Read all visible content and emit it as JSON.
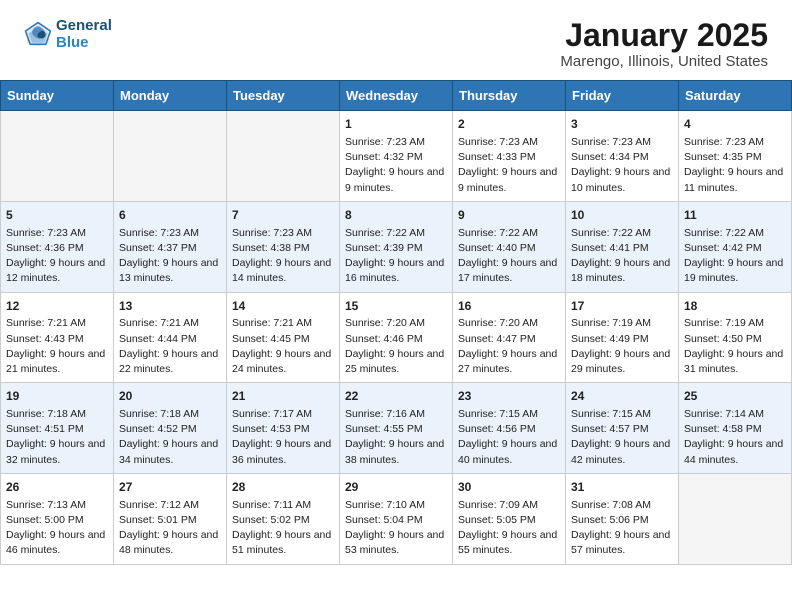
{
  "header": {
    "logo_line1": "General",
    "logo_line2": "Blue",
    "title": "January 2025",
    "subtitle": "Marengo, Illinois, United States"
  },
  "weekdays": [
    "Sunday",
    "Monday",
    "Tuesday",
    "Wednesday",
    "Thursday",
    "Friday",
    "Saturday"
  ],
  "weeks": [
    [
      {
        "day": "",
        "sunrise": "",
        "sunset": "",
        "daylight": "",
        "empty": true
      },
      {
        "day": "",
        "sunrise": "",
        "sunset": "",
        "daylight": "",
        "empty": true
      },
      {
        "day": "",
        "sunrise": "",
        "sunset": "",
        "daylight": "",
        "empty": true
      },
      {
        "day": "1",
        "sunrise": "Sunrise: 7:23 AM",
        "sunset": "Sunset: 4:32 PM",
        "daylight": "Daylight: 9 hours and 9 minutes."
      },
      {
        "day": "2",
        "sunrise": "Sunrise: 7:23 AM",
        "sunset": "Sunset: 4:33 PM",
        "daylight": "Daylight: 9 hours and 9 minutes."
      },
      {
        "day": "3",
        "sunrise": "Sunrise: 7:23 AM",
        "sunset": "Sunset: 4:34 PM",
        "daylight": "Daylight: 9 hours and 10 minutes."
      },
      {
        "day": "4",
        "sunrise": "Sunrise: 7:23 AM",
        "sunset": "Sunset: 4:35 PM",
        "daylight": "Daylight: 9 hours and 11 minutes."
      }
    ],
    [
      {
        "day": "5",
        "sunrise": "Sunrise: 7:23 AM",
        "sunset": "Sunset: 4:36 PM",
        "daylight": "Daylight: 9 hours and 12 minutes."
      },
      {
        "day": "6",
        "sunrise": "Sunrise: 7:23 AM",
        "sunset": "Sunset: 4:37 PM",
        "daylight": "Daylight: 9 hours and 13 minutes."
      },
      {
        "day": "7",
        "sunrise": "Sunrise: 7:23 AM",
        "sunset": "Sunset: 4:38 PM",
        "daylight": "Daylight: 9 hours and 14 minutes."
      },
      {
        "day": "8",
        "sunrise": "Sunrise: 7:22 AM",
        "sunset": "Sunset: 4:39 PM",
        "daylight": "Daylight: 9 hours and 16 minutes."
      },
      {
        "day": "9",
        "sunrise": "Sunrise: 7:22 AM",
        "sunset": "Sunset: 4:40 PM",
        "daylight": "Daylight: 9 hours and 17 minutes."
      },
      {
        "day": "10",
        "sunrise": "Sunrise: 7:22 AM",
        "sunset": "Sunset: 4:41 PM",
        "daylight": "Daylight: 9 hours and 18 minutes."
      },
      {
        "day": "11",
        "sunrise": "Sunrise: 7:22 AM",
        "sunset": "Sunset: 4:42 PM",
        "daylight": "Daylight: 9 hours and 19 minutes."
      }
    ],
    [
      {
        "day": "12",
        "sunrise": "Sunrise: 7:21 AM",
        "sunset": "Sunset: 4:43 PM",
        "daylight": "Daylight: 9 hours and 21 minutes."
      },
      {
        "day": "13",
        "sunrise": "Sunrise: 7:21 AM",
        "sunset": "Sunset: 4:44 PM",
        "daylight": "Daylight: 9 hours and 22 minutes."
      },
      {
        "day": "14",
        "sunrise": "Sunrise: 7:21 AM",
        "sunset": "Sunset: 4:45 PM",
        "daylight": "Daylight: 9 hours and 24 minutes."
      },
      {
        "day": "15",
        "sunrise": "Sunrise: 7:20 AM",
        "sunset": "Sunset: 4:46 PM",
        "daylight": "Daylight: 9 hours and 25 minutes."
      },
      {
        "day": "16",
        "sunrise": "Sunrise: 7:20 AM",
        "sunset": "Sunset: 4:47 PM",
        "daylight": "Daylight: 9 hours and 27 minutes."
      },
      {
        "day": "17",
        "sunrise": "Sunrise: 7:19 AM",
        "sunset": "Sunset: 4:49 PM",
        "daylight": "Daylight: 9 hours and 29 minutes."
      },
      {
        "day": "18",
        "sunrise": "Sunrise: 7:19 AM",
        "sunset": "Sunset: 4:50 PM",
        "daylight": "Daylight: 9 hours and 31 minutes."
      }
    ],
    [
      {
        "day": "19",
        "sunrise": "Sunrise: 7:18 AM",
        "sunset": "Sunset: 4:51 PM",
        "daylight": "Daylight: 9 hours and 32 minutes."
      },
      {
        "day": "20",
        "sunrise": "Sunrise: 7:18 AM",
        "sunset": "Sunset: 4:52 PM",
        "daylight": "Daylight: 9 hours and 34 minutes."
      },
      {
        "day": "21",
        "sunrise": "Sunrise: 7:17 AM",
        "sunset": "Sunset: 4:53 PM",
        "daylight": "Daylight: 9 hours and 36 minutes."
      },
      {
        "day": "22",
        "sunrise": "Sunrise: 7:16 AM",
        "sunset": "Sunset: 4:55 PM",
        "daylight": "Daylight: 9 hours and 38 minutes."
      },
      {
        "day": "23",
        "sunrise": "Sunrise: 7:15 AM",
        "sunset": "Sunset: 4:56 PM",
        "daylight": "Daylight: 9 hours and 40 minutes."
      },
      {
        "day": "24",
        "sunrise": "Sunrise: 7:15 AM",
        "sunset": "Sunset: 4:57 PM",
        "daylight": "Daylight: 9 hours and 42 minutes."
      },
      {
        "day": "25",
        "sunrise": "Sunrise: 7:14 AM",
        "sunset": "Sunset: 4:58 PM",
        "daylight": "Daylight: 9 hours and 44 minutes."
      }
    ],
    [
      {
        "day": "26",
        "sunrise": "Sunrise: 7:13 AM",
        "sunset": "Sunset: 5:00 PM",
        "daylight": "Daylight: 9 hours and 46 minutes."
      },
      {
        "day": "27",
        "sunrise": "Sunrise: 7:12 AM",
        "sunset": "Sunset: 5:01 PM",
        "daylight": "Daylight: 9 hours and 48 minutes."
      },
      {
        "day": "28",
        "sunrise": "Sunrise: 7:11 AM",
        "sunset": "Sunset: 5:02 PM",
        "daylight": "Daylight: 9 hours and 51 minutes."
      },
      {
        "day": "29",
        "sunrise": "Sunrise: 7:10 AM",
        "sunset": "Sunset: 5:04 PM",
        "daylight": "Daylight: 9 hours and 53 minutes."
      },
      {
        "day": "30",
        "sunrise": "Sunrise: 7:09 AM",
        "sunset": "Sunset: 5:05 PM",
        "daylight": "Daylight: 9 hours and 55 minutes."
      },
      {
        "day": "31",
        "sunrise": "Sunrise: 7:08 AM",
        "sunset": "Sunset: 5:06 PM",
        "daylight": "Daylight: 9 hours and 57 minutes."
      },
      {
        "day": "",
        "sunrise": "",
        "sunset": "",
        "daylight": "",
        "empty": true
      }
    ]
  ]
}
